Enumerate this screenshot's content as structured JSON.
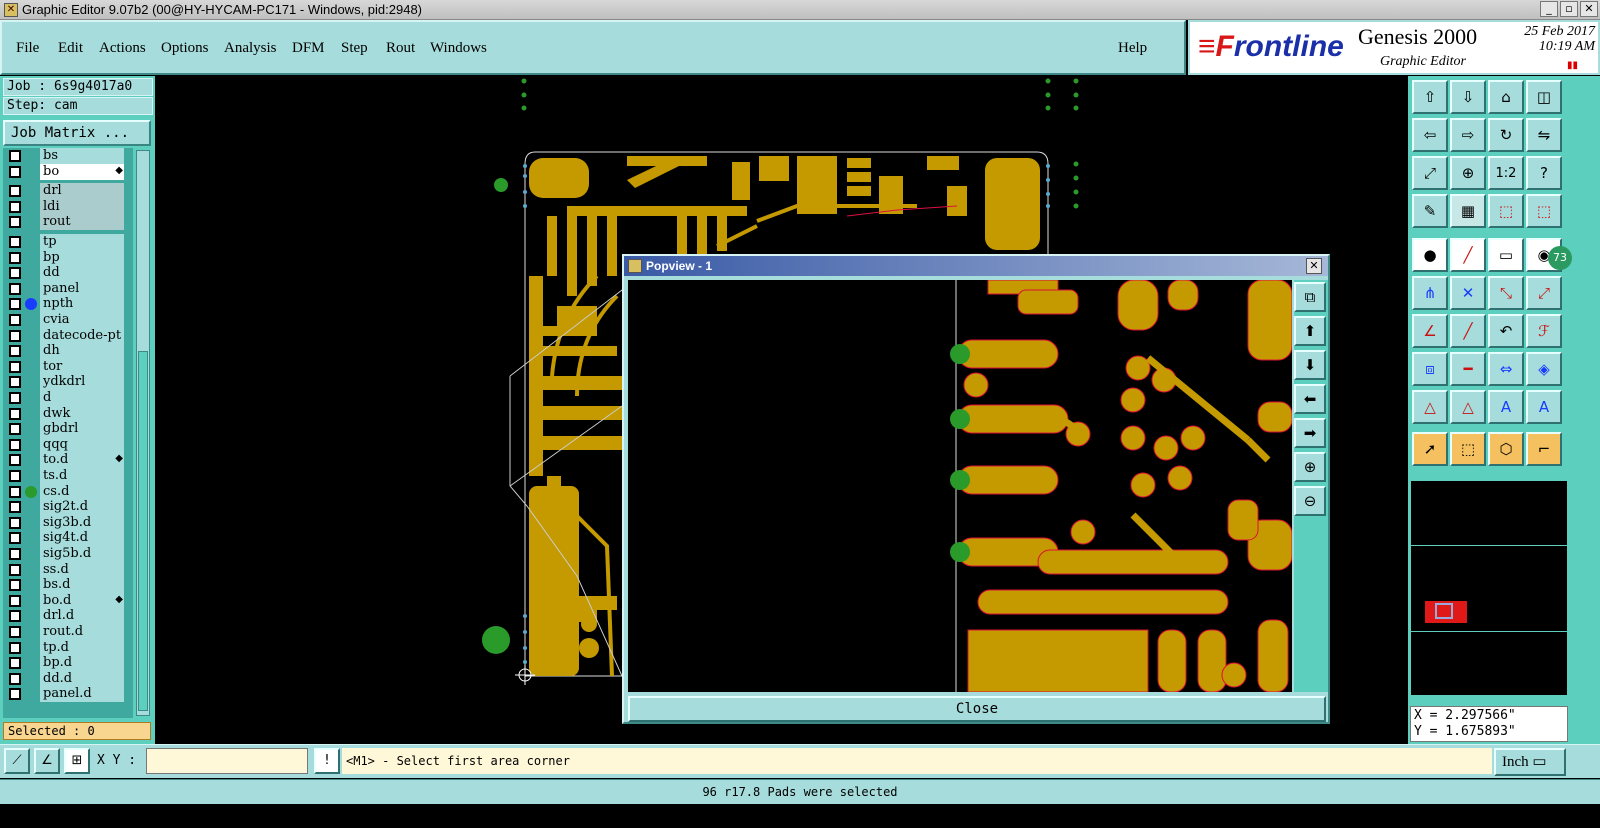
{
  "window": {
    "title": "Graphic Editor 9.07b2 (00@HY-HYCAM-PC171 - Windows, pid:2948)"
  },
  "menu": {
    "items": [
      "File",
      "Edit",
      "Actions",
      "Options",
      "Analysis",
      "DFM",
      "Step",
      "Rout",
      "Windows"
    ],
    "help": "Help"
  },
  "brand": {
    "logo_red": "≡F",
    "logo_rest": "rontline",
    "product": "Genesis 2000",
    "subtitle": "Graphic Editor",
    "date": "25 Feb 2017",
    "time": "10:19 AM"
  },
  "job": {
    "job_label": "Job : 6s9g4017a0",
    "step_label": "Step: cam",
    "job_matrix": "Job Matrix ..."
  },
  "layers": [
    {
      "name": "bs",
      "style": "plain",
      "dot": ""
    },
    {
      "name": "bo",
      "style": "white",
      "dot": "",
      "mark": true
    },
    {
      "name": "drl",
      "style": "gray",
      "dot": ""
    },
    {
      "name": "ldi",
      "style": "gray",
      "dot": ""
    },
    {
      "name": "rout",
      "style": "gray",
      "dot": ""
    },
    {
      "name": "tp",
      "style": "plain",
      "dot": ""
    },
    {
      "name": "bp",
      "style": "plain",
      "dot": ""
    },
    {
      "name": "dd",
      "style": "plain",
      "dot": ""
    },
    {
      "name": "panel",
      "style": "plain",
      "dot": ""
    },
    {
      "name": "npth",
      "style": "plain",
      "dot": "#1a3cff"
    },
    {
      "name": "cvia",
      "style": "plain",
      "dot": ""
    },
    {
      "name": "datecode-pt",
      "style": "plain",
      "dot": ""
    },
    {
      "name": "dh",
      "style": "plain",
      "dot": ""
    },
    {
      "name": "tor",
      "style": "plain",
      "dot": ""
    },
    {
      "name": "ydkdrl",
      "style": "plain",
      "dot": ""
    },
    {
      "name": "d",
      "style": "plain",
      "dot": ""
    },
    {
      "name": "dwk",
      "style": "plain",
      "dot": ""
    },
    {
      "name": "gbdrl",
      "style": "plain",
      "dot": ""
    },
    {
      "name": "qqq",
      "style": "plain",
      "dot": ""
    },
    {
      "name": "to.d",
      "style": "plain",
      "dot": "",
      "mark": true
    },
    {
      "name": "ts.d",
      "style": "plain",
      "dot": ""
    },
    {
      "name": "cs.d",
      "style": "plain",
      "dot": "#2a9a2a"
    },
    {
      "name": "sig2t.d",
      "style": "plain",
      "dot": ""
    },
    {
      "name": "sig3b.d",
      "style": "plain",
      "dot": ""
    },
    {
      "name": "sig4t.d",
      "style": "plain",
      "dot": ""
    },
    {
      "name": "sig5b.d",
      "style": "plain",
      "dot": ""
    },
    {
      "name": "ss.d",
      "style": "plain",
      "dot": ""
    },
    {
      "name": "bs.d",
      "style": "plain",
      "dot": ""
    },
    {
      "name": "bo.d",
      "style": "plain",
      "dot": "",
      "mark": true
    },
    {
      "name": "drl.d",
      "style": "plain",
      "dot": ""
    },
    {
      "name": "rout.d",
      "style": "plain",
      "dot": ""
    },
    {
      "name": "tp.d",
      "style": "plain",
      "dot": ""
    },
    {
      "name": "bp.d",
      "style": "plain",
      "dot": ""
    },
    {
      "name": "dd.d",
      "style": "plain",
      "dot": ""
    },
    {
      "name": "panel.d",
      "style": "plain",
      "dot": ""
    }
  ],
  "selected": "Selected : 0",
  "popview": {
    "title": "Popview - 1",
    "close_label": "Close"
  },
  "toolbar_icons": [
    "home-icon",
    "zoom-icon",
    "1:2",
    "question-icon",
    "scale-icon",
    "snap-icon",
    "grid-icon",
    "measure-icon"
  ],
  "coords": {
    "x": "X = 2.297566\"",
    "y": "Y = 1.675893\""
  },
  "input": {
    "xy_label": "X Y :",
    "xy_value": "",
    "prompt": "<M1> - Select first area corner",
    "unit": "Inch"
  },
  "status": "96 r17.8 Pads were selected",
  "colors": {
    "copper": "#c49a00",
    "panel_bg": "#a6dcdc",
    "accent": "#5ccfbe"
  }
}
